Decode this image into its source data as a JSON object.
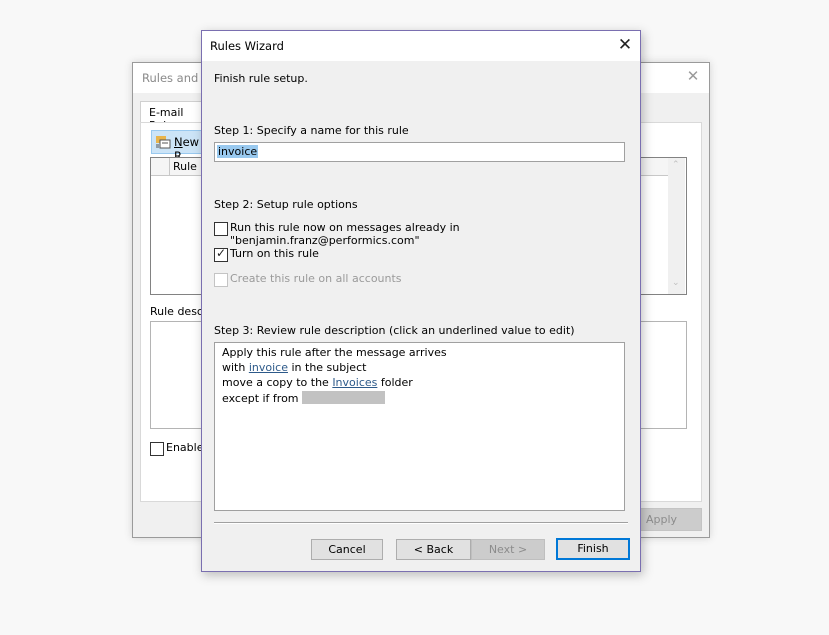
{
  "background_dialog": {
    "title": "Rules and A",
    "tab_label": "E-mail Rule",
    "new_rule_label": "New R",
    "new_rule_mnemonic": "N",
    "list_column_label": "Rule (",
    "scroll_up_glyph": "⌃",
    "scroll_down_glyph": "⌄",
    "description_label": "Rule descr",
    "enable_label": "Enable",
    "apply_label": "Apply",
    "close_glyph": "✕"
  },
  "wizard": {
    "title": "Rules Wizard",
    "close_glyph": "✕",
    "subtitle": "Finish rule setup.",
    "step1": {
      "label": "Step 1: Specify a name for this rule",
      "name_value": "invoice"
    },
    "step2": {
      "label": "Step 2: Setup rule options",
      "options": [
        {
          "label": "Run this rule now on messages already in \"benjamin.franz@performics.com\"",
          "checked": false,
          "enabled": true
        },
        {
          "label": "Turn on this rule",
          "checked": true,
          "enabled": true
        },
        {
          "label": "Create this rule on all accounts",
          "checked": false,
          "enabled": false
        }
      ],
      "check_glyph": "✓"
    },
    "step3": {
      "label": "Step 3: Review rule description (click an underlined value to edit)",
      "lines": {
        "l1": "Apply this rule after the message arrives",
        "l2_pre": "with ",
        "l2_link": "invoice",
        "l2_post": " in the subject",
        "l3_pre": "move a copy to the ",
        "l3_link": "Invoices",
        "l3_post": " folder",
        "l4_pre": "except if from "
      }
    },
    "buttons": {
      "cancel": "Cancel",
      "back": "< Back",
      "next": "Next >",
      "finish": "Finish"
    }
  },
  "colors": {
    "accent": "#0078d7",
    "link": "#2d5a8a",
    "selection": "#99c9ef"
  }
}
